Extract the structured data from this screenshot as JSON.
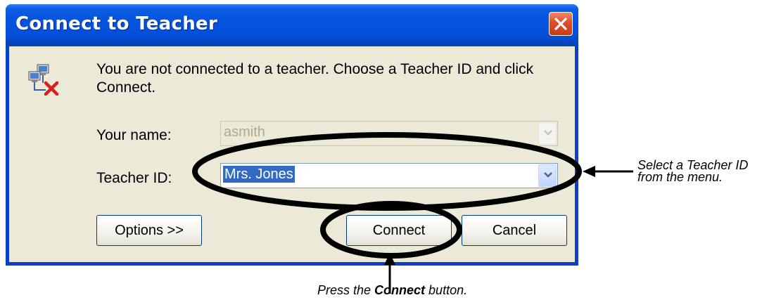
{
  "dialog": {
    "title": "Connect to Teacher",
    "close_icon": "close-x",
    "message": "You are not connected to a teacher. Choose a Teacher ID and click Connect.",
    "status_icon": "network-disconnected-icon",
    "fields": {
      "name_label": "Your name:",
      "name_value": "asmith",
      "teacher_label": "Teacher ID:",
      "teacher_value": "Mrs. Jones"
    },
    "buttons": {
      "options": "Options >>",
      "connect": "Connect",
      "cancel": "Cancel"
    }
  },
  "annotations": {
    "teacher_note_line1": "Select a Teacher ID",
    "teacher_note_line2": "from the menu.",
    "connect_note_pre": "Press the ",
    "connect_note_bold": "Connect",
    "connect_note_post": " button."
  },
  "colors": {
    "titlebar": "#0553de",
    "client": "#ece9d8",
    "close": "#de4d26",
    "selection": "#316ac5"
  }
}
